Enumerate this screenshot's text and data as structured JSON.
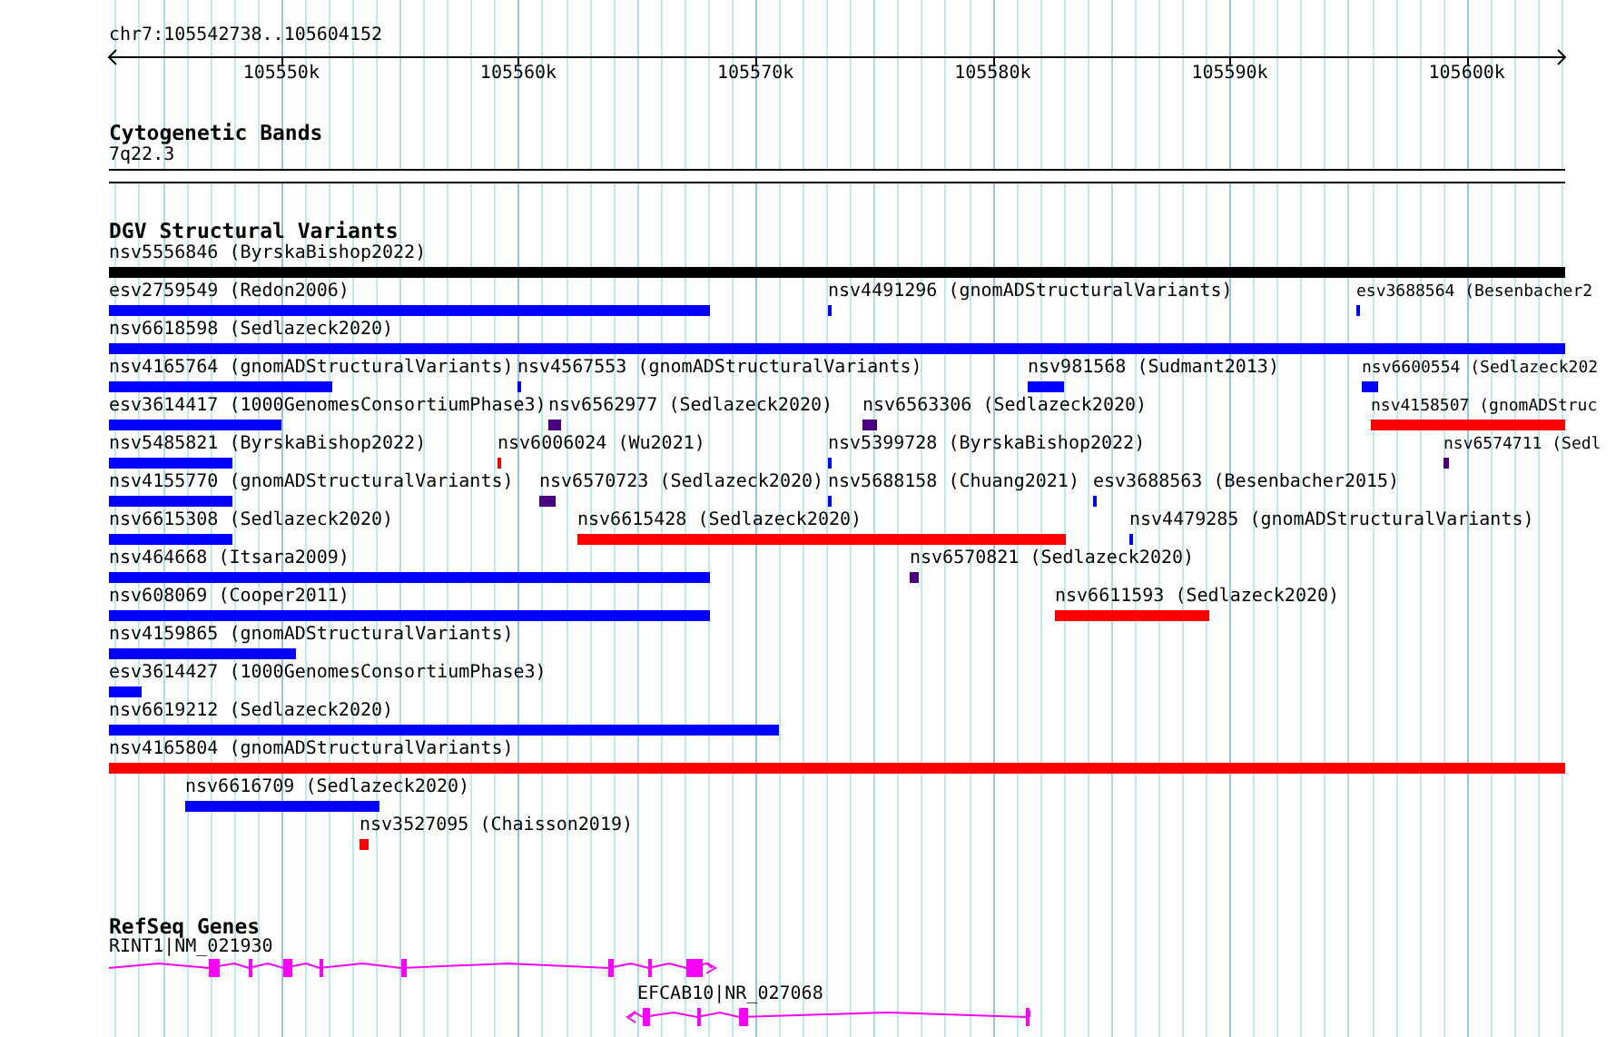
{
  "ruler": {
    "location": "chr7:105542738..105604152",
    "ticks": [
      "105550k",
      "105560k",
      "105570k",
      "105580k",
      "105590k",
      "105600k"
    ]
  },
  "cytogenetic_bands": {
    "title": "Cytogenetic Bands",
    "band": "7q22.3"
  },
  "dgv": {
    "title": "DGV Structural Variants",
    "rows": [
      [
        {
          "label": "nsv5556846 (ByrskaBishop2022)",
          "color": "#000000"
        }
      ],
      [
        {
          "label": "esv2759549 (Redon2006)",
          "color": "#0000ff"
        },
        {
          "label": "nsv4491296 (gnomADStructuralVariants)",
          "color": "#0000ff"
        },
        {
          "label": "esv3688564 (Besenbacher2",
          "color": "#0000ff"
        }
      ],
      [
        {
          "label": "nsv6618598 (Sedlazeck2020)",
          "color": "#0000ff"
        }
      ],
      [
        {
          "label": "nsv4165764 (gnomADStructuralVariants)",
          "color": "#0000ff"
        },
        {
          "label": "nsv4567553 (gnomADStructuralVariants)",
          "color": "#0000ff"
        },
        {
          "label": "nsv981568 (Sudmant2013)",
          "color": "#0000ff"
        },
        {
          "label": "nsv6600554 (Sedlazeck202",
          "color": "#0000ff"
        }
      ],
      [
        {
          "label": "esv3614417 (1000GenomesConsortiumPhase3)",
          "color": "#0000ff"
        },
        {
          "label": "nsv6562977 (Sedlazeck2020)",
          "color": "#4b0082"
        },
        {
          "label": "nsv6563306 (Sedlazeck2020)",
          "color": "#4b0082"
        },
        {
          "label": "nsv4158507 (gnomADStruc",
          "color": "#ff0000"
        }
      ],
      [
        {
          "label": "nsv5485821 (ByrskaBishop2022)",
          "color": "#0000ff"
        },
        {
          "label": "nsv6006024 (Wu2021)",
          "color": "#ff0000"
        },
        {
          "label": "nsv5399728 (ByrskaBishop2022)",
          "color": "#0000ff"
        },
        {
          "label": "nsv6574711 (Sedl",
          "color": "#4b0082"
        }
      ],
      [
        {
          "label": "nsv4155770 (gnomADStructuralVariants)",
          "color": "#0000ff"
        },
        {
          "label": "nsv6570723 (Sedlazeck2020)",
          "color": "#4b0082"
        },
        {
          "label": "nsv5688158 (Chuang2021)",
          "color": "#0000ff"
        },
        {
          "label": "esv3688563 (Besenbacher2015)",
          "color": "#0000ff"
        }
      ],
      [
        {
          "label": "nsv6615308 (Sedlazeck2020)",
          "color": "#0000ff"
        },
        {
          "label": "nsv6615428 (Sedlazeck2020)",
          "color": "#ff0000"
        },
        {
          "label": "nsv4479285 (gnomADStructuralVariants)",
          "color": "#0000ff"
        }
      ],
      [
        {
          "label": "nsv464668 (Itsara2009)",
          "color": "#0000ff"
        },
        {
          "label": "nsv6570821 (Sedlazeck2020)",
          "color": "#4b0082"
        }
      ],
      [
        {
          "label": "nsv608069 (Cooper2011)",
          "color": "#0000ff"
        },
        {
          "label": "nsv6611593 (Sedlazeck2020)",
          "color": "#ff0000"
        }
      ],
      [
        {
          "label": "nsv4159865 (gnomADStructuralVariants)",
          "color": "#0000ff"
        }
      ],
      [
        {
          "label": "esv3614427 (1000GenomesConsortiumPhase3)",
          "color": "#0000ff"
        }
      ],
      [
        {
          "label": "nsv6619212 (Sedlazeck2020)",
          "color": "#0000ff"
        }
      ],
      [
        {
          "label": "nsv4165804 (gnomADStructuralVariants)",
          "color": "#ff0000"
        }
      ],
      [
        {
          "label": "nsv6616709 (Sedlazeck2020)",
          "color": "#0000ff"
        }
      ],
      [
        {
          "label": "nsv3527095 (Chaisson2019)",
          "color": "#ff0000"
        }
      ]
    ]
  },
  "refseq_genes": {
    "title": "RefSeq Genes",
    "genes": [
      {
        "label": "RINT1|NM_021930",
        "reverse_strand": false
      },
      {
        "label": "EFCAB10|NR_027068",
        "reverse_strand": true
      }
    ]
  }
}
